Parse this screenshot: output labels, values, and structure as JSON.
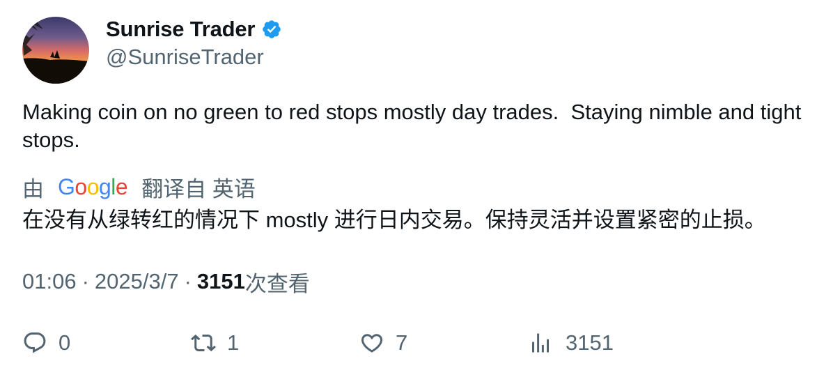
{
  "author": {
    "display_name": "Sunrise Trader",
    "handle": "@SunriseTrader",
    "verified": true
  },
  "tweet": {
    "text": "Making coin on no green to red stops mostly day trades.  Staying nimble and tight stops."
  },
  "translation": {
    "by_label": "由",
    "provider_letters": [
      "G",
      "o",
      "o",
      "g",
      "l",
      "e"
    ],
    "from_label": "翻译自 英语",
    "text": "在没有从绿转红的情况下 mostly 进行日内交易。保持灵活并设置紧密的止损。"
  },
  "meta": {
    "time": "01:06",
    "separator": "·",
    "date": "2025/3/7",
    "views_count": "3151",
    "views_label": "次查看"
  },
  "actions": {
    "reply_count": "0",
    "retweet_count": "1",
    "like_count": "7",
    "views_count": "3151"
  },
  "colors": {
    "text_primary": "#0f1419",
    "text_secondary": "#536471",
    "verified_badge": "#1d9bf0"
  },
  "icons": [
    "verified-badge-icon",
    "reply-icon",
    "retweet-icon",
    "like-icon",
    "views-icon"
  ]
}
